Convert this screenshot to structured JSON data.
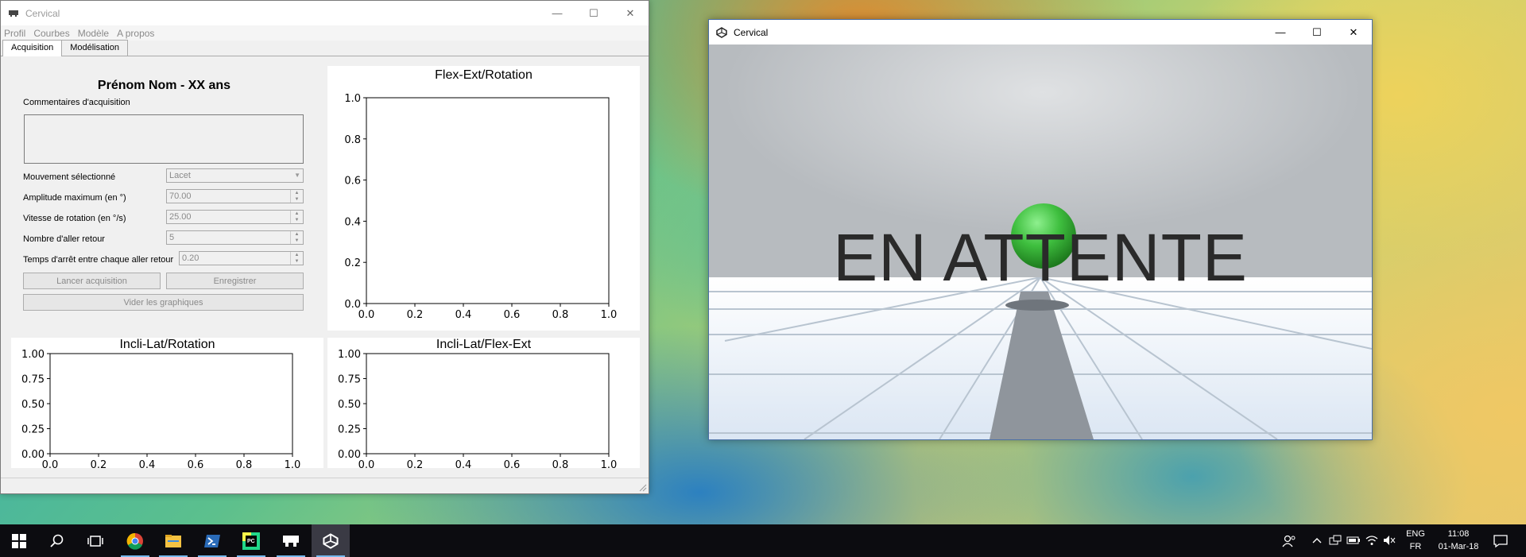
{
  "left_window": {
    "title": "Cervical",
    "caption": {
      "minimize": "—",
      "maximize": "☐",
      "close": "✕"
    },
    "menu": [
      "Profil",
      "Courbes",
      "Modèle",
      "A propos"
    ],
    "tabs": [
      {
        "label": "Acquisition",
        "active": true
      },
      {
        "label": "Modélisation",
        "active": false
      }
    ],
    "form": {
      "person": "Prénom Nom - XX ans",
      "comment_label": "Commentaires d'acquisition",
      "comment_value": "",
      "movement_label": "Mouvement sélectionné",
      "movement_value": "Lacet",
      "amplitude_label": "Amplitude maximum (en °)",
      "amplitude_value": "70.00",
      "speed_label": "Vitesse de rotation (en °/s)",
      "speed_value": "25.00",
      "count_label": "Nombre d'aller retour",
      "count_value": "5",
      "pause_label": "Temps d'arrêt entre chaque aller retour",
      "pause_value": "0.20",
      "start_button": "Lancer acquisition",
      "save_button": "Enregistrer",
      "clear_button": "Vider les graphiques"
    },
    "charts": [
      {
        "title": "Flex-Ext/Rotation",
        "xticks": [
          "0.0",
          "0.2",
          "0.4",
          "0.6",
          "0.8",
          "1.0"
        ],
        "yticks": [
          "0.0",
          "0.2",
          "0.4",
          "0.6",
          "0.8",
          "1.0"
        ]
      },
      {
        "title": "Incli-Lat/Rotation",
        "xticks": [
          "0.0",
          "0.2",
          "0.4",
          "0.6",
          "0.8",
          "1.0"
        ],
        "yticks": [
          "0.00",
          "0.25",
          "0.50",
          "0.75",
          "1.00"
        ]
      },
      {
        "title": "Incli-Lat/Flex-Ext",
        "xticks": [
          "0.0",
          "0.2",
          "0.4",
          "0.6",
          "0.8",
          "1.0"
        ],
        "yticks": [
          "0.00",
          "0.25",
          "0.50",
          "0.75",
          "1.00"
        ]
      }
    ]
  },
  "right_window": {
    "title": "Cervical",
    "caption": {
      "minimize": "—",
      "maximize": "☐",
      "close": "✕"
    },
    "scene_text": "EN ATTENTE",
    "ball_color": "#3fbf3f"
  },
  "taskbar": {
    "apps": [
      "start-icon",
      "search-icon",
      "task-view-icon",
      "chrome-icon",
      "file-explorer-icon",
      "powershell-icon",
      "pycharm-icon",
      "app-icon",
      "unity-icon"
    ],
    "language_top": "ENG",
    "language_bottom": "FR",
    "time": "11:08",
    "date": "01-Mar-18"
  },
  "colors": {
    "taskbar_bg": "#0c0c10",
    "accent": "#76b9ed",
    "window_border": "#4a6fa5"
  }
}
